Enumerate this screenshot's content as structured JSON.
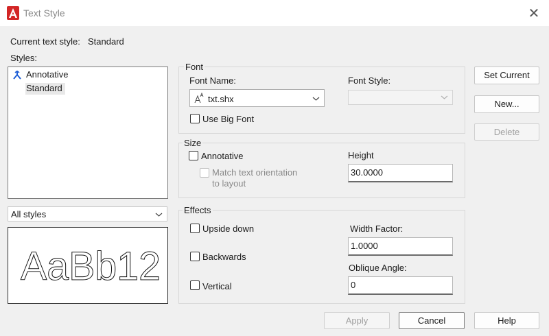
{
  "window": {
    "title": "Text Style",
    "accent_color": "#d32626"
  },
  "current_style": {
    "label": "Current text style:",
    "value": "Standard"
  },
  "styles": {
    "label": "Styles:",
    "items": [
      {
        "label": "Annotative",
        "icon": "annotative-icon"
      },
      {
        "label": "Standard",
        "selected": true
      }
    ],
    "filter_value": "All styles"
  },
  "preview": {
    "sample_text": "AaBb12"
  },
  "font": {
    "group_label": "Font",
    "font_name_label": "Font Name:",
    "font_name_value": "txt.shx",
    "font_style_label": "Font Style:",
    "font_style_value": "",
    "big_font_label": "Use Big Font"
  },
  "size": {
    "group_label": "Size",
    "annotative_label": "Annotative",
    "match_label_line1": "Match text orientation",
    "match_label_line2": "to layout",
    "height_label": "Height",
    "height_value": "30.0000"
  },
  "effects": {
    "group_label": "Effects",
    "upside_down_label": "Upside down",
    "backwards_label": "Backwards",
    "vertical_label": "Vertical",
    "width_factor_label": "Width Factor:",
    "width_factor_value": "1.0000",
    "oblique_label": "Oblique Angle:",
    "oblique_value": "0"
  },
  "side_buttons": {
    "set_current": "Set Current",
    "new": "New...",
    "delete": "Delete"
  },
  "footer": {
    "apply": "Apply",
    "cancel": "Cancel",
    "help": "Help"
  }
}
